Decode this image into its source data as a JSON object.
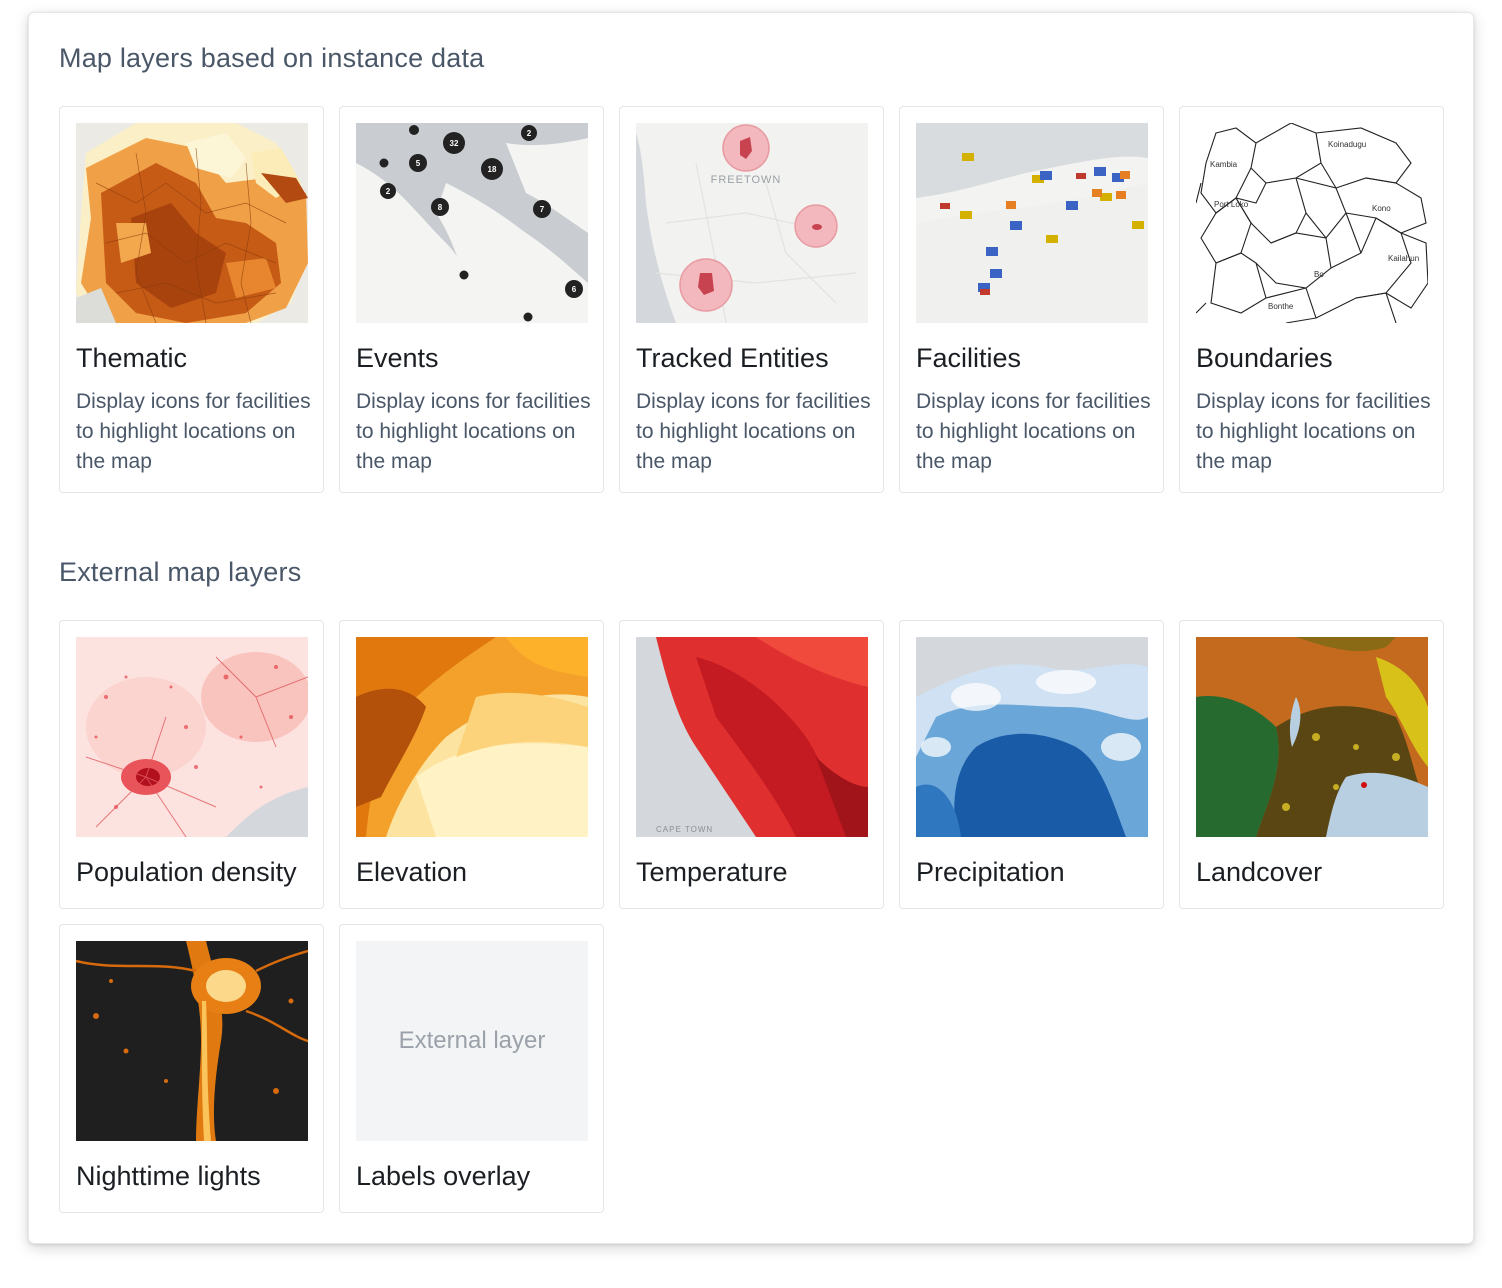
{
  "sections": {
    "instance": {
      "title": "Map layers based on instance data",
      "cards": [
        {
          "title": "Thematic",
          "description": "Display icons for facilities to highlight locations on the map"
        },
        {
          "title": "Events",
          "description": "Display icons for facilities to highlight locations on the map"
        },
        {
          "title": "Tracked Entities",
          "description": "Display icons for facilities to highlight locations on the map"
        },
        {
          "title": "Facilities",
          "description": "Display icons for facilities to highlight locations on the map"
        },
        {
          "title": "Boundaries",
          "description": "Display icons for facilities to highlight locations on the map"
        }
      ]
    },
    "external": {
      "title": "External map layers",
      "cards": [
        {
          "title": "Population density"
        },
        {
          "title": "Elevation"
        },
        {
          "title": "Temperature"
        },
        {
          "title": "Precipitation"
        },
        {
          "title": "Landcover"
        },
        {
          "title": "Nighttime lights"
        },
        {
          "title": "Labels overlay",
          "thumb_text": "External layer"
        }
      ]
    }
  },
  "map_labels": {
    "events_clusters": [
      "32",
      "18",
      "5",
      "2",
      "7",
      "6",
      "8",
      "2"
    ],
    "tracked_city": "FREETOWN",
    "boundaries": [
      "Kambia",
      "Koinadugu",
      "Port Loko",
      "Kono",
      "Bo",
      "Kailahun",
      "Bonthe"
    ],
    "temperature_city": "CAPE TOWN"
  },
  "colors": {
    "section_title": "#4a5768",
    "card_title": "#1b1f24",
    "card_desc": "#4a5768",
    "card_border": "#e2e6ea"
  }
}
